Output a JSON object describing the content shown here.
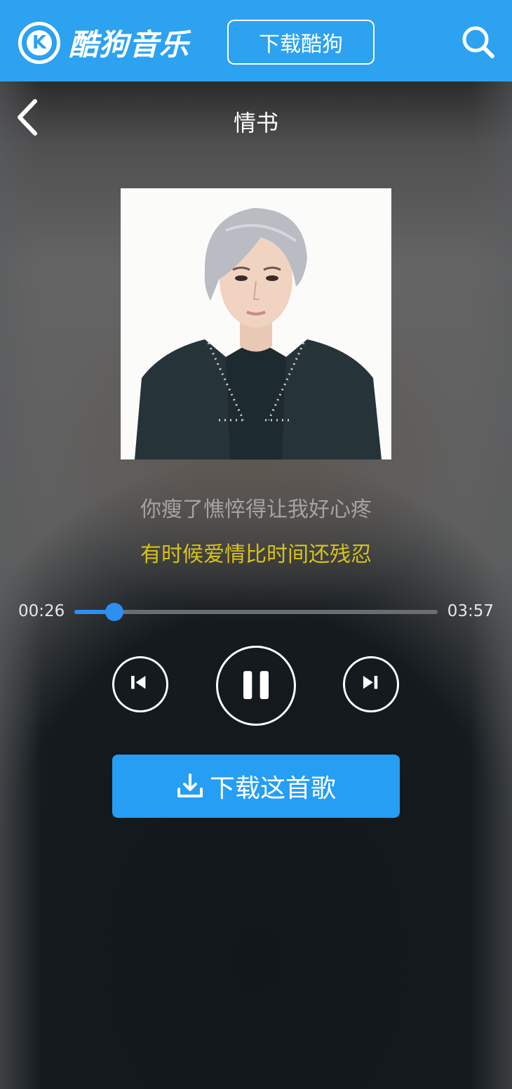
{
  "header": {
    "logo_mark": "K",
    "logo_text": "酷狗音乐",
    "download_app_label": "下载酷狗",
    "search_icon": "search-icon"
  },
  "player": {
    "song_title": "情书",
    "back_icon": "chevron-left-icon",
    "lyrics": {
      "previous": "你瘦了憔悴得让我好心疼",
      "current": "有时候爱情比时间还残忍"
    },
    "time_current": "00:26",
    "time_total": "03:57",
    "progress_fraction": 0.11,
    "controls": {
      "prev_icon": "skip-previous-icon",
      "pause_icon": "pause-icon",
      "next_icon": "skip-next-icon"
    },
    "download_song_label": "下载这首歌"
  },
  "colors": {
    "brand_blue": "#2ca2f1",
    "button_blue": "#259ef4",
    "progress_blue": "#2d8ff0",
    "lyric_current": "#d6c21a",
    "lyric_previous": "#a4a4a4"
  }
}
